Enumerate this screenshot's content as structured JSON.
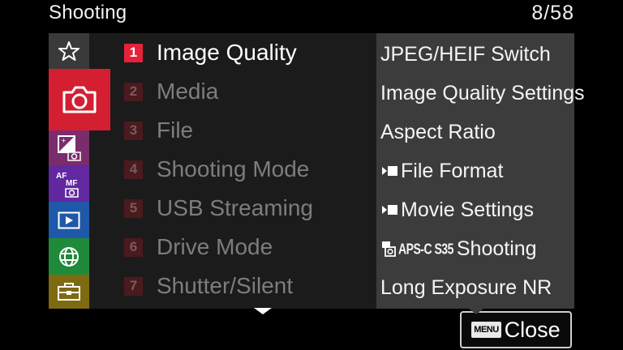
{
  "header": {
    "title": "Shooting",
    "page": "8/58"
  },
  "sidebar": {
    "tabs": [
      {
        "name": "my-menu",
        "icon": "star-icon",
        "color": "#3a3a3a"
      },
      {
        "name": "shooting",
        "icon": "camera-icon",
        "color": "#d41f33",
        "selected": true
      },
      {
        "name": "exposure-color",
        "icon": "exposure-camera-icon",
        "color": "#7a2c6c"
      },
      {
        "name": "focus",
        "icon": "af-mf-icon",
        "color": "#6128a0",
        "text": "AF MF"
      },
      {
        "name": "playback",
        "icon": "play-icon",
        "color": "#1f58a8"
      },
      {
        "name": "network",
        "icon": "globe-icon",
        "color": "#1f8a3a"
      },
      {
        "name": "setup",
        "icon": "toolbox-icon",
        "color": "#7e6a10"
      }
    ]
  },
  "menu": {
    "items": [
      {
        "num": "1",
        "label": "Image Quality",
        "active": true
      },
      {
        "num": "2",
        "label": "Media",
        "active": false
      },
      {
        "num": "3",
        "label": "File",
        "active": false
      },
      {
        "num": "4",
        "label": "Shooting Mode",
        "active": false
      },
      {
        "num": "5",
        "label": "USB Streaming",
        "active": false
      },
      {
        "num": "6",
        "label": "Drive Mode",
        "active": false
      },
      {
        "num": "7",
        "label": "Shutter/Silent",
        "active": false
      }
    ]
  },
  "details": {
    "items": [
      {
        "label": "JPEG/HEIF Switch"
      },
      {
        "label": "Image Quality Settings"
      },
      {
        "label": "Aspect Ratio"
      },
      {
        "label": "File Format",
        "icon": "movie-icon"
      },
      {
        "label": "Movie Settings",
        "icon": "movie-icon"
      },
      {
        "label": "Shooting",
        "icon": "apsc-camera-icon",
        "prefix": "APS-C S35"
      },
      {
        "label": "Long Exposure NR"
      }
    ]
  },
  "footer": {
    "badge": "MENU",
    "close_label": "Close"
  },
  "colors": {
    "accent": "#e8213a",
    "background": "#000000",
    "menu_bg": "#1b1b1b",
    "detail_bg": "#3c3c3c"
  }
}
